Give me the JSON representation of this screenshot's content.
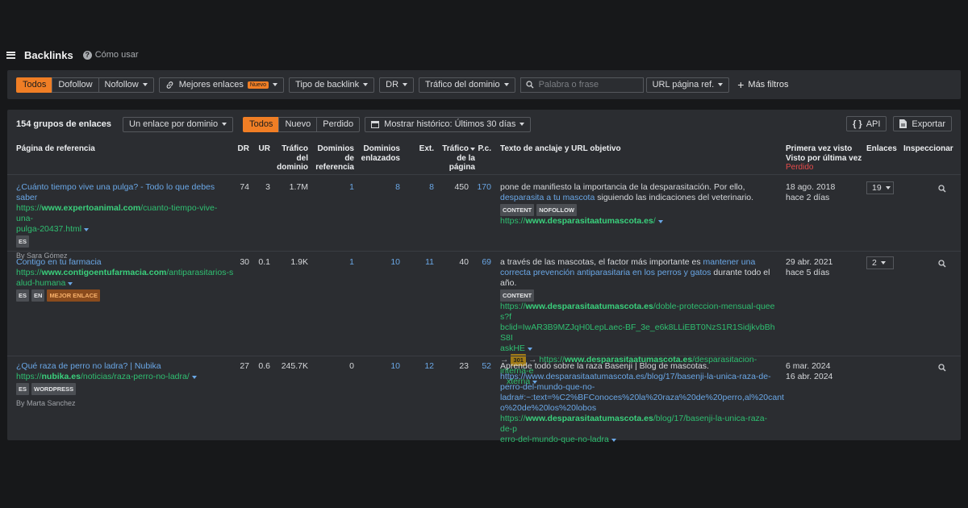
{
  "header": {
    "title": "Backlinks",
    "help": "Cómo usar"
  },
  "filters": {
    "seg": [
      "Todos",
      "Dofollow",
      "Nofollow"
    ],
    "best_links": "Mejores enlaces",
    "new_badge": "Nuevo",
    "backlink_type": "Tipo de backlink",
    "dr": "DR",
    "domain_traffic": "Tráfico del dominio",
    "search_placeholder": "Palabra o frase",
    "url_ref": "URL página ref.",
    "more_filters": "Más filtros"
  },
  "panel": {
    "groups": "154 grupos de enlaces",
    "per_domain": "Un enlace por dominio",
    "status_seg": [
      "Todos",
      "Nuevo",
      "Perdido"
    ],
    "history": "Mostrar histórico: Últimos 30 días",
    "api": "API",
    "export": "Exportar"
  },
  "columns": {
    "ref_page": "Página de referencia",
    "dr": "DR",
    "ur": "UR",
    "traffic": [
      "Tráfico",
      "del",
      "dominio"
    ],
    "ref_domains": [
      "Dominios",
      "de",
      "referencia"
    ],
    "linked_domains": [
      "Dominios",
      "enlazados"
    ],
    "ext": "Ext.",
    "page_traffic": [
      "Tráfico",
      "de la",
      "página"
    ],
    "pc": "P.c.",
    "anchor": "Texto de anclaje y URL objetivo",
    "first_seen": "Primera vez visto",
    "last_seen": "Visto por última vez",
    "lost": "Perdido",
    "links": "Enlaces",
    "inspect": "Inspeccionar"
  },
  "rows": [
    {
      "title": [
        "¿Cuánto tiempo vive una pulga? - Todo lo que debes",
        "saber"
      ],
      "url": [
        "https://",
        "www.expertoanimal.com",
        "/cuanto-tiempo-vive-una-",
        "pulga-20437.html"
      ],
      "tags": [
        "ES"
      ],
      "author": "By Sara Gómez",
      "dr": "74",
      "ur": "3",
      "traffic": "1.7M",
      "ref_domains": "1",
      "linked_domains": "8",
      "ext": "8",
      "page_traffic": "450",
      "pc": "170",
      "anchor": [
        "pone de manifiesto la importancia de la desparasitación. Por ello,",
        "desparasita a tu mascota",
        " siguiendo las indicaciones del veterinario."
      ],
      "anchor_tags": [
        "CONTENT",
        "NOFOLLOW"
      ],
      "target": [
        "https://",
        "www.desparasitaatumascota.es",
        "/"
      ],
      "first_seen": "18 ago. 2018",
      "last_seen": "hace 2 días",
      "links": "19"
    },
    {
      "title": [
        "Contigo en tu farmacia"
      ],
      "url": [
        "https://",
        "www.contigoentufarmacia.com",
        "/antiparasitarios-s",
        "alud-humana"
      ],
      "tags": [
        "ES",
        "EN",
        "MEJOR ENLACE"
      ],
      "dr": "30",
      "ur": "0.1",
      "traffic": "1.9K",
      "ref_domains": "1",
      "linked_domains": "10",
      "ext": "11",
      "page_traffic": "40",
      "pc": "69",
      "anchor": [
        "a través de las mascotas, el factor más importante es ",
        "mantener una",
        "correcta prevención antiparasitaria en los perros y gatos",
        " durante todo el",
        "año."
      ],
      "anchor_tags": [
        "CONTENT"
      ],
      "target": [
        "https://",
        "www.desparasitaatumascota.es",
        "/doble-proteccion-mensual-quees?f",
        "bclid=IwAR3B9MZJqH0LepLaec-BF_3e_e6k8LLiEBT0NzS1R1SidjkvbBhS8I",
        "askHE"
      ],
      "redirect_code": "301",
      "redirect": [
        "https://",
        "www.desparasitaatumascota.es",
        "/desparasitacion-interna-e",
        "xterna"
      ],
      "first_seen": "29 abr. 2021",
      "last_seen": "hace 5 días",
      "links": "2"
    },
    {
      "title": [
        "¿Qué raza de perro no ladra? | Nubika"
      ],
      "url": [
        "https://",
        "nubika.es",
        "/noticias/raza-perro-no-ladra/"
      ],
      "tags": [
        "ES",
        "WORDPRESS"
      ],
      "author": "By Marta Sanchez",
      "dr": "27",
      "ur": "0.6",
      "traffic": "245.7K",
      "ref_domains": "0",
      "linked_domains": "10",
      "ext": "12",
      "page_traffic": "23",
      "pc": "52",
      "anchor": [
        "Aprende todo sobre la raza Basenji | Blog de mascotas.",
        "https://www.desparasitaatumascota.es/blog/17/basenji-la-unica-raza-de-",
        "perro-del-mundo-que-no-",
        "ladra#:~:text=%C2%BFConoces%20la%20raza%20de%20perro,al%20cant",
        "o%20de%20los%20lobos"
      ],
      "target": [
        "https://",
        "www.desparasitaatumascota.es",
        "/blog/17/basenji-la-unica-raza-de-p",
        "erro-del-mundo-que-no-ladra"
      ],
      "first_seen": "6 mar. 2024",
      "last_seen": "16 abr. 2024"
    }
  ]
}
